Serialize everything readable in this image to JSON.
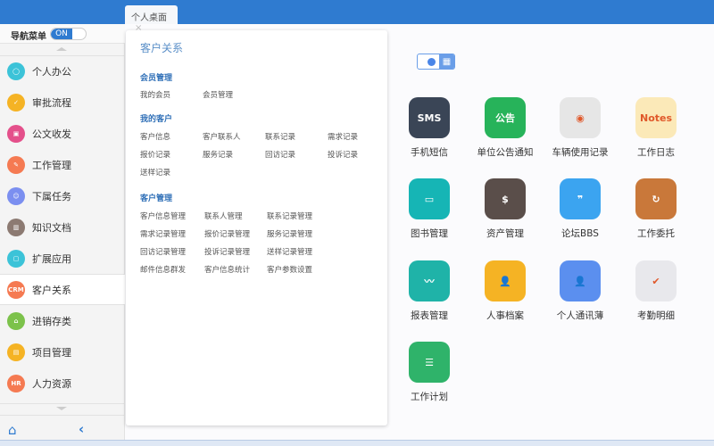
{
  "tab": {
    "label": "个人桌面",
    "close": "×"
  },
  "nav": {
    "label": "导航菜单",
    "toggle": "ON"
  },
  "sidebar": {
    "items": [
      {
        "label": "个人办公",
        "icon": "user-icon",
        "color": "#3cc3d8",
        "glyph": "◯"
      },
      {
        "label": "审批流程",
        "icon": "approval-icon",
        "color": "#f5b324",
        "glyph": "✓"
      },
      {
        "label": "公文收发",
        "icon": "document-exchange-icon",
        "color": "#e4508b",
        "glyph": "▣"
      },
      {
        "label": "工作管理",
        "icon": "work-icon",
        "color": "#f57a52",
        "glyph": "✎"
      },
      {
        "label": "下属任务",
        "icon": "team-icon",
        "color": "#7b8ff0",
        "glyph": "☺"
      },
      {
        "label": "知识文档",
        "icon": "book-icon",
        "color": "#8c7a72",
        "glyph": "▥"
      },
      {
        "label": "扩展应用",
        "icon": "extension-icon",
        "color": "#3cc3d8",
        "glyph": "▢"
      },
      {
        "label": "客户关系",
        "icon": "crm-icon",
        "color": "#f57a52",
        "glyph": "CRM"
      },
      {
        "label": "进销存类",
        "icon": "inventory-icon",
        "color": "#7cc24b",
        "glyph": "⌂"
      },
      {
        "label": "项目管理",
        "icon": "project-icon",
        "color": "#f5b324",
        "glyph": "▤"
      },
      {
        "label": "人力资源",
        "icon": "hr-icon",
        "color": "#f57a52",
        "glyph": "HR"
      }
    ]
  },
  "popup": {
    "title": "客户关系",
    "sections": [
      {
        "title": "会员管理",
        "links": [
          "我的会员",
          "会员管理"
        ]
      },
      {
        "title": "我的客户",
        "links": [
          "客户信息",
          "客户联系人",
          "联系记录",
          "需求记录",
          "报价记录",
          "服务记录",
          "回访记录",
          "投诉记录",
          "送样记录"
        ]
      },
      {
        "title": "客户管理",
        "links": [
          "客户信息管理",
          "联系人管理",
          "联系记录管理",
          "需求记录管理",
          "报价记录管理",
          "服务记录管理",
          "回访记录管理",
          "投诉记录管理",
          "送样记录管理",
          "邮件信息群发",
          "客户信息统计",
          "客户参数设置"
        ]
      }
    ]
  },
  "apps": [
    {
      "label": "手机短信",
      "icon": "sms-icon",
      "color": "#3a4556",
      "glyph": "SMS"
    },
    {
      "label": "单位公告通知",
      "icon": "announcement-icon",
      "color": "#27b35a",
      "glyph": "公告"
    },
    {
      "label": "车辆使用记录",
      "icon": "speedometer-icon",
      "color": "#e6e6e6",
      "glyph": "◉"
    },
    {
      "label": "工作日志",
      "icon": "notes-icon",
      "color": "#fbe9b8",
      "glyph": "Notes"
    },
    {
      "label": "图书管理",
      "icon": "book-icon",
      "color": "#16b5b5",
      "glyph": "▭"
    },
    {
      "label": "资产管理",
      "icon": "asset-icon",
      "color": "#5a4e4a",
      "glyph": "$"
    },
    {
      "label": "论坛BBS",
      "icon": "forum-icon",
      "color": "#3ba4f0",
      "glyph": "❞"
    },
    {
      "label": "工作委托",
      "icon": "delegate-icon",
      "color": "#c9783a",
      "glyph": "↻"
    },
    {
      "label": "报表管理",
      "icon": "report-icon",
      "color": "#1fb3a8",
      "glyph": "〰"
    },
    {
      "label": "人事档案",
      "icon": "personnel-file-icon",
      "color": "#f5b324",
      "glyph": "👤"
    },
    {
      "label": "个人通讯薄",
      "icon": "contacts-icon",
      "color": "#5b8fef",
      "glyph": "👤"
    },
    {
      "label": "考勤明细",
      "icon": "attendance-icon",
      "color": "#e8e8ec",
      "glyph": "✔"
    },
    {
      "label": "工作计划",
      "icon": "plan-icon",
      "color": "#2fb36a",
      "glyph": "☰"
    }
  ]
}
